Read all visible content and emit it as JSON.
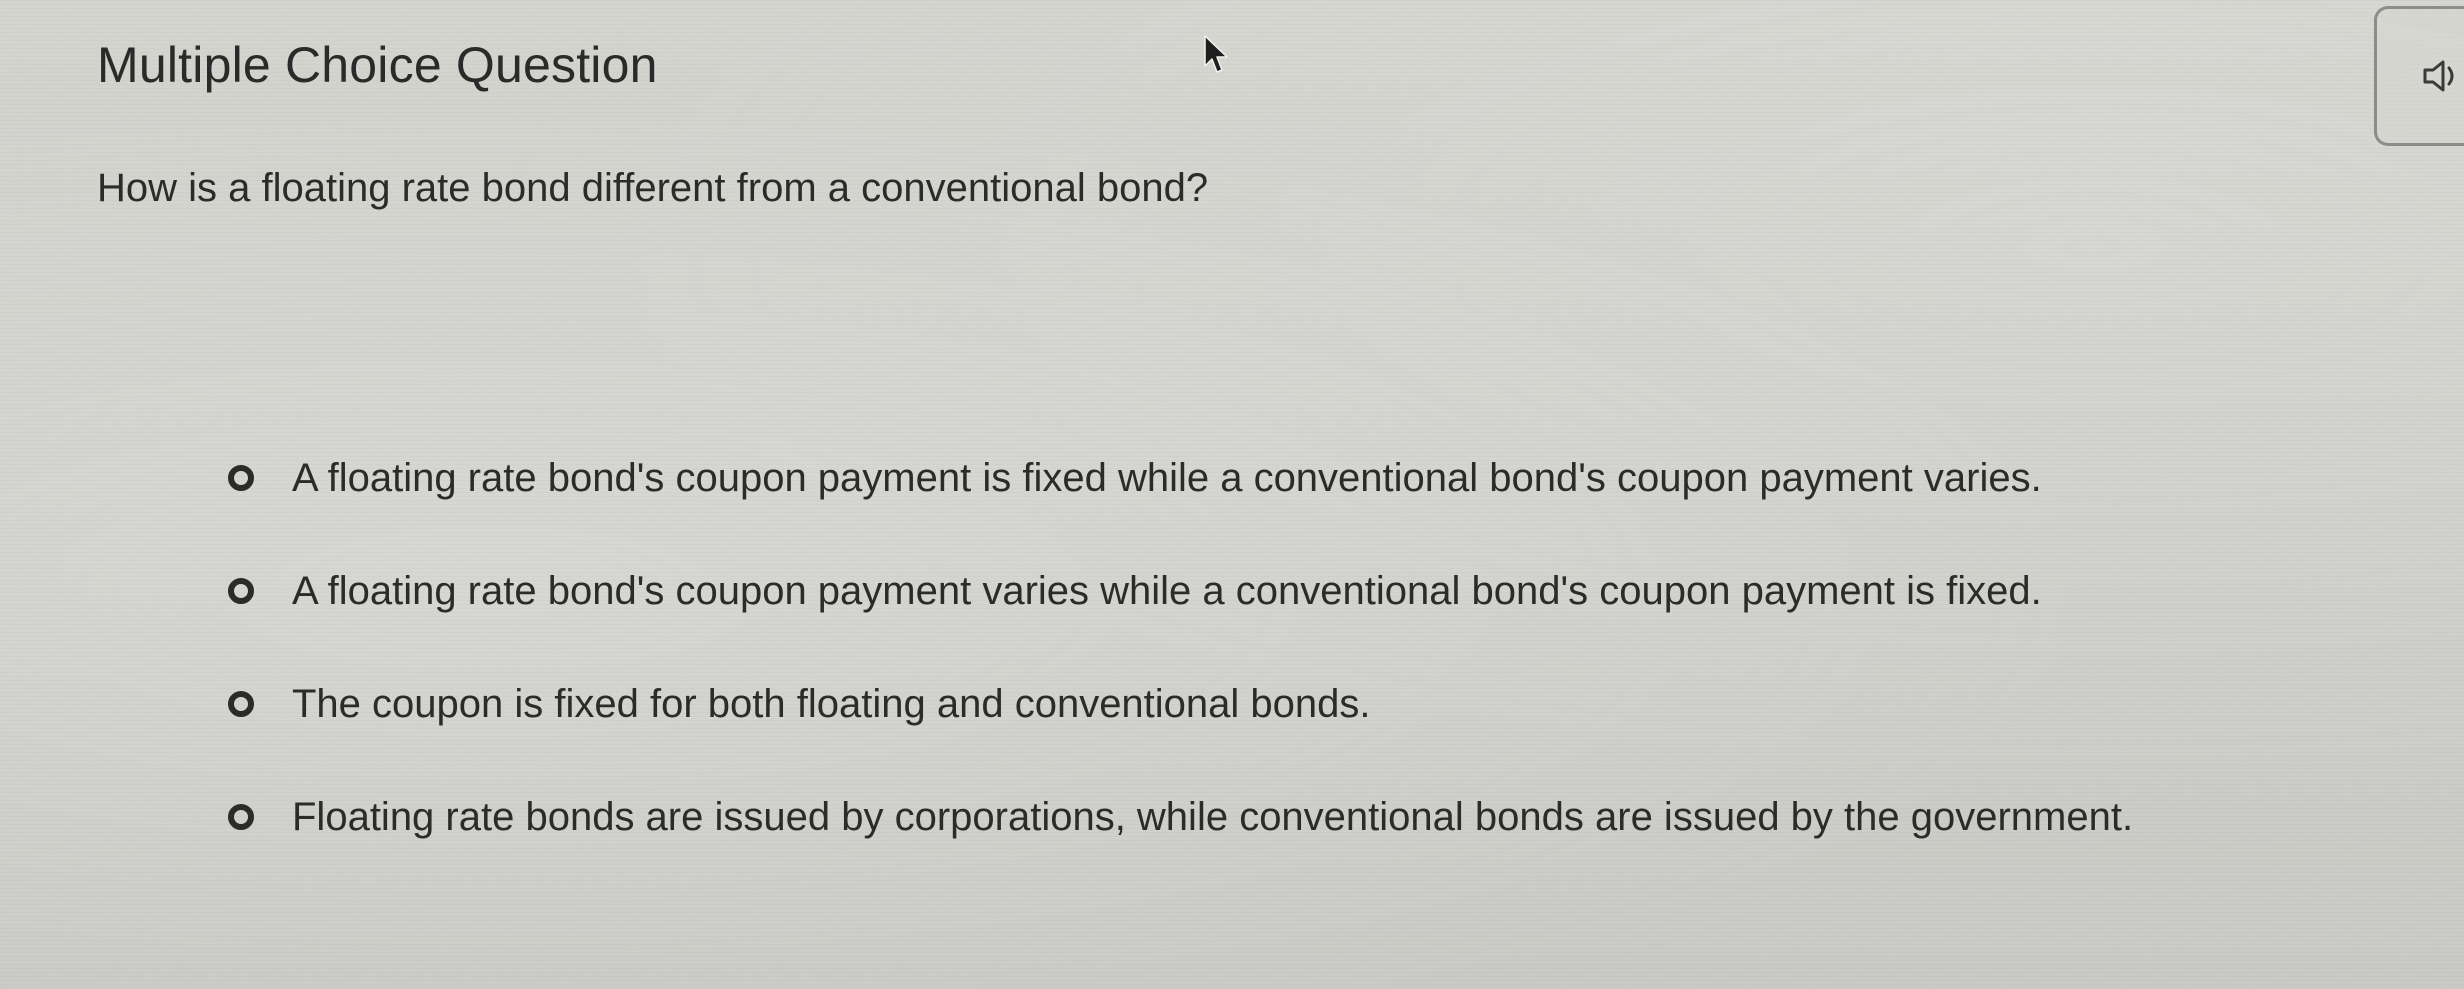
{
  "question": {
    "title": "Multiple Choice Question",
    "prompt": "How is a floating rate bond different from a conventional bond?"
  },
  "audio_button": {
    "icon": "speaker-icon"
  },
  "choices": [
    {
      "label": "A floating rate bond's coupon payment is fixed while a conventional bond's coupon payment varies."
    },
    {
      "label": "A floating rate bond's coupon payment varies while a conventional bond's coupon payment is fixed."
    },
    {
      "label": "The coupon is fixed for both floating and conventional bonds."
    },
    {
      "label": "Floating rate bonds are issued by corporations, while conventional bonds are issued by the government."
    }
  ],
  "colors": {
    "background": "#d0d1cc",
    "text": "#2b2b2b",
    "border": "#8c8c8a"
  }
}
